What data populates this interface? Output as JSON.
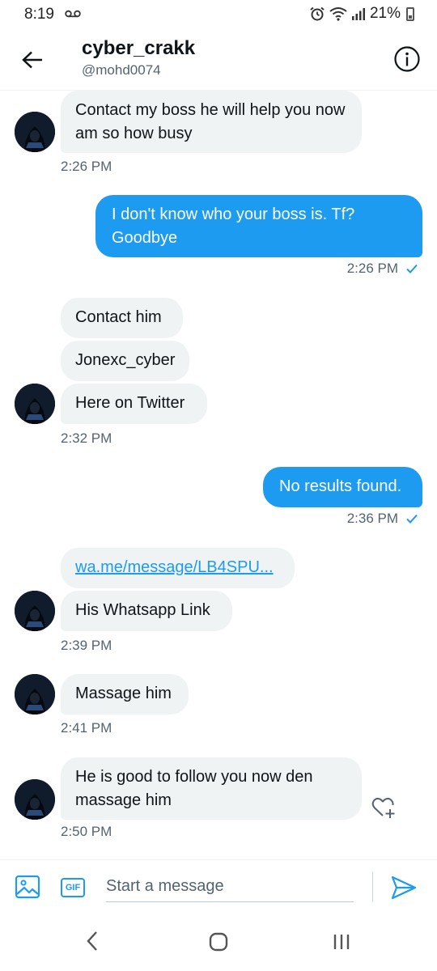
{
  "status_bar": {
    "time": "8:19",
    "battery": "21%"
  },
  "header": {
    "name": "cyber_crakk",
    "handle": "@mohd0074"
  },
  "messages": {
    "m1": {
      "text": "Contact my boss he will help you now am so how busy",
      "time": "2:26 PM"
    },
    "m2": {
      "text": "I don't know who your boss is. Tf? Goodbye",
      "time": "2:26 PM"
    },
    "m3": {
      "lines": [
        "Contact him",
        "Jonexc_cyber",
        "Here on Twitter"
      ],
      "time": "2:32 PM"
    },
    "m4": {
      "text": "No results found.",
      "time": "2:36 PM"
    },
    "m5": {
      "link": "wa.me/message/LB4SPU...",
      "text": "His Whatsapp Link",
      "time": "2:39 PM"
    },
    "m6": {
      "text": "Massage him",
      "time": "2:41 PM"
    },
    "m7": {
      "text": "He is good to follow you now den massage him",
      "time": "2:50 PM"
    }
  },
  "composer": {
    "placeholder": "Start a message",
    "gif_label": "GIF"
  },
  "colors": {
    "accent": "#1d9bf0",
    "incoming_bubble": "#eff3f4",
    "secondary_text": "#536471"
  },
  "icons": [
    "back-arrow-icon",
    "info-icon",
    "read-check-icon",
    "heart-add-icon",
    "image-icon",
    "gif-icon",
    "send-icon",
    "nav-back-icon",
    "nav-home-icon",
    "nav-recents-icon"
  ]
}
